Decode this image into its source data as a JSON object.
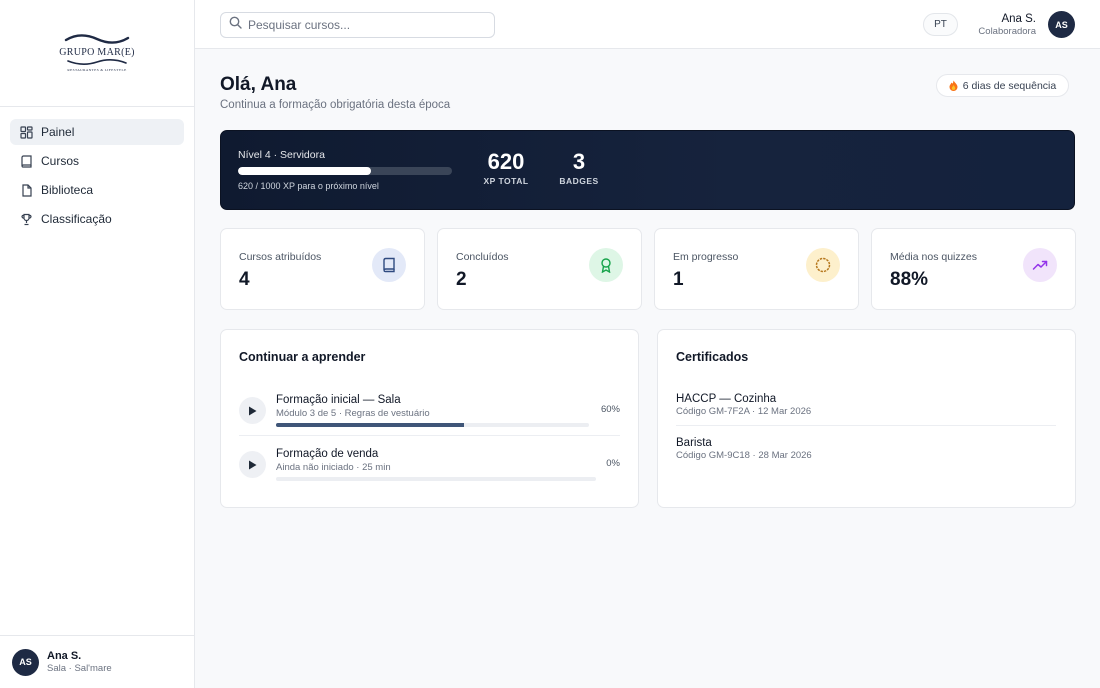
{
  "brand": {
    "logo_title": "GRUPO MAR(E)",
    "logo_subtitle": "RESTAURANTES & LIFESTYLE"
  },
  "sidebar": {
    "items": [
      {
        "label": "Painel",
        "icon": "dashboard-icon",
        "active": true
      },
      {
        "label": "Cursos",
        "icon": "book-icon",
        "active": false
      },
      {
        "label": "Biblioteca",
        "icon": "document-icon",
        "active": false
      },
      {
        "label": "Classificação",
        "icon": "trophy-icon",
        "active": false
      }
    ],
    "user": {
      "initials": "AS",
      "name": "Ana S.",
      "role": "Sala · Sal'mare"
    }
  },
  "topbar": {
    "search_placeholder": "Pesquisar cursos...",
    "language": "PT",
    "user": {
      "name": "Ana S.",
      "role": "Colaboradora",
      "initials": "AS"
    }
  },
  "greeting": {
    "title": "Olá, Ana",
    "subtitle": "Continua a formação obrigatória desta época",
    "streak": "6 dias de sequência"
  },
  "level": {
    "label": "Nível 4 · Servidora",
    "xp_progress": 0.62,
    "xp_text": "620 / 1000 XP para o próximo nível",
    "xp_total": "620",
    "xp_total_label": "XP TOTAL",
    "badges": "3",
    "badges_label": "BADGES"
  },
  "stats": [
    {
      "label": "Cursos atribuídos",
      "value": "4",
      "icon": "book-icon",
      "icon_bg": "#e3e9f8",
      "icon_color": "#2f4a80"
    },
    {
      "label": "Concluídos",
      "value": "2",
      "icon": "award-icon",
      "icon_bg": "#def6e6",
      "icon_color": "#16a34a"
    },
    {
      "label": "Em progresso",
      "value": "1",
      "icon": "progress-circle-icon",
      "icon_bg": "#fdf0cc",
      "icon_color": "#b7791f"
    },
    {
      "label": "Média nos quizzes",
      "value": "88%",
      "icon": "trend-up-icon",
      "icon_bg": "#f1e4fb",
      "icon_color": "#9333ea"
    }
  ],
  "continue_learning": {
    "title": "Continuar a aprender",
    "courses": [
      {
        "title": "Formação inicial — Sala",
        "subtitle": "Módulo 3 de 5 · Regras de vestuário",
        "progress": 0.6,
        "percent": "60%"
      },
      {
        "title": "Formação de venda",
        "subtitle": "Ainda não iniciado · 25 min",
        "progress": 0,
        "percent": "0%"
      }
    ]
  },
  "certificates": {
    "title": "Certificados",
    "items": [
      {
        "title": "HACCP — Cozinha",
        "subtitle": "Código GM-7F2A · 12 Mar 2026"
      },
      {
        "title": "Barista",
        "subtitle": "Código GM-9C18 · 28 Mar 2026"
      }
    ]
  }
}
